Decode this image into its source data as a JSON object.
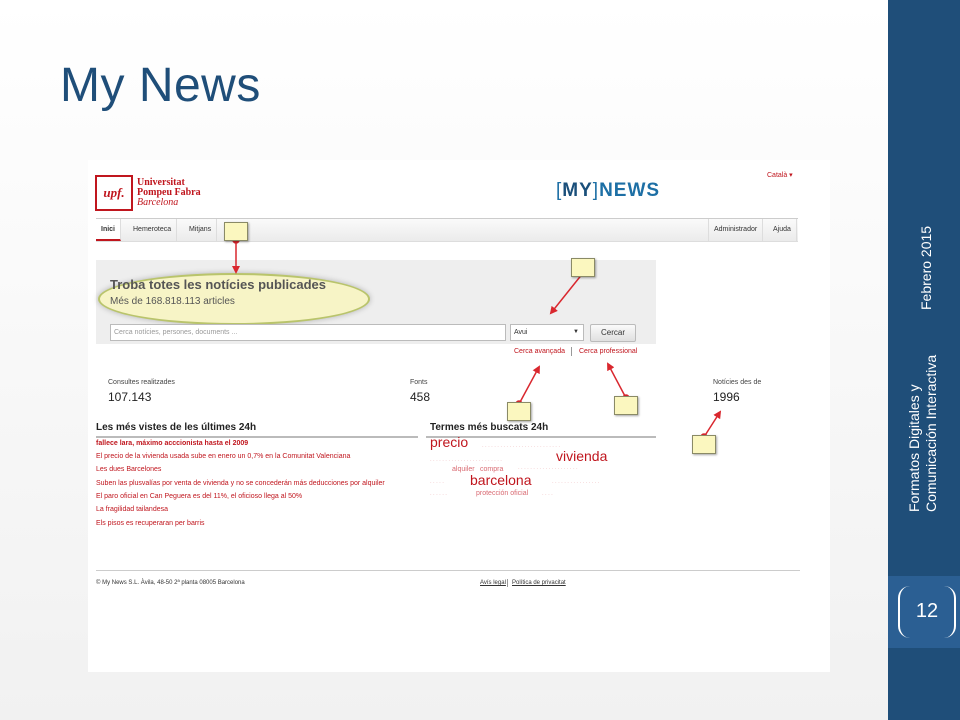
{
  "slide": {
    "title": "My News",
    "date": "Febrero 2015",
    "course_line1": "Formatos Digitales y",
    "course_line2": "Comunicación Interactiva",
    "page_number": "12",
    "accent_color": "#1f4e79"
  },
  "site": {
    "upf_mark": "upf.",
    "upf_line1": "Universitat",
    "upf_line2": "Pompeu Fabra",
    "upf_line3": "Barcelona",
    "logo_open": "[",
    "logo_my": "MY",
    "logo_close": "]",
    "logo_news": "NEWS",
    "language": "Català ▾",
    "brand_color": "#c0161e",
    "nav": {
      "inici": "Inici",
      "hemeroteca": "Hemeroteca",
      "mitjans": "Mitjans",
      "admin": "Administrador",
      "help": "Ajuda"
    },
    "search": {
      "title": "Troba totes les notícies publicades",
      "subtitle": "Més de 168.818.113 articles",
      "placeholder": "Cerca notícies, persones, documents ...",
      "scope": "Avui",
      "button": "Cercar",
      "advanced": "Cerca avançada",
      "professional": "Cerca professional"
    },
    "stats": {
      "queries_label": "Consultes realitzades",
      "queries_value": "107.143",
      "sources_label": "Fonts",
      "sources_value": "458",
      "news_since_label": "Notícies des de",
      "news_since_value": "1996"
    },
    "most_viewed": {
      "heading": "Les més vistes de les últimes 24h",
      "items": [
        "fallece lara, máximo acccionista hasta el 2009",
        "El precio de la vivienda usada sube en enero un 0,7% en la Comunitat Valenciana",
        "Les dues Barcelones",
        "Suben las plusvalías por venta de vivienda y no se concederán más deducciones por alquiler",
        "El paro oficial en Can Peguera es del 11%, el oficioso llega al 50%",
        "La fragilidad tailandesa",
        "Els pisos es recuperaran per barris"
      ]
    },
    "top_terms": {
      "heading": "Termes més buscats 24h",
      "precio": "precio",
      "vivienda": "vivienda",
      "barcelona": "barcelona",
      "alquiler": "alquiler",
      "compra": "compra",
      "proteccion": "protección oficial"
    },
    "footer": {
      "company": "© My News S.L. Àvila, 48-50 2ª planta 08005 Barcelona",
      "legal": "Avís legal",
      "privacy": "Política de privacitat"
    }
  }
}
